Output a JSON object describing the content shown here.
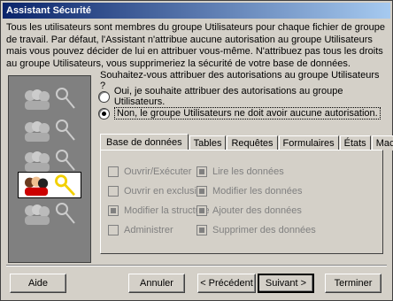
{
  "window": {
    "title": "Assistant Sécurité"
  },
  "intro": "Tous les utilisateurs sont membres du groupe Utilisateurs pour chaque fichier de groupe de travail. Par défaut, l'Assistant n'attribue aucune autorisation au groupe Utilisateurs mais vous pouvez décider de lui en attribuer vous-même. N'attribuez pas tous les droits au groupe Utilisateurs, vous supprimeriez la sécurité de votre base de données.",
  "question": "Souhaitez-vous attribuer des autorisations au groupe Utilisateurs ?",
  "options": [
    {
      "label": "Oui, je souhaite attribuer des autorisations au groupe Utilisateurs.",
      "selected": false
    },
    {
      "label": "Non, le groupe Utilisateurs ne doit avoir aucune autorisation.",
      "selected": true
    }
  ],
  "tabs": [
    "Base de données",
    "Tables",
    "Requêtes",
    "Formulaires",
    "États",
    "Macros"
  ],
  "permissions": {
    "left": [
      {
        "label": "Ouvrir/Exécuter",
        "checked": false
      },
      {
        "label": "Ouvrir en exclusif",
        "checked": false
      },
      {
        "label": "Modifier la structure",
        "checked": true
      },
      {
        "label": "Administrer",
        "checked": false
      }
    ],
    "right": [
      {
        "label": "Lire les données",
        "checked": true
      },
      {
        "label": "Modifier les données",
        "checked": true
      },
      {
        "label": "Ajouter des données",
        "checked": true
      },
      {
        "label": "Supprimer des données",
        "checked": true
      }
    ]
  },
  "buttons": {
    "help": "Aide",
    "cancel": "Annuler",
    "back": "< Précédent",
    "next": "Suivant >",
    "finish": "Terminer"
  },
  "icons": {
    "group": "users-group-icon",
    "key": "key-icon"
  },
  "colors": {
    "dialog": "#d4d0c8",
    "title_start": "#0a246a",
    "title_end": "#a6caf0",
    "key_active": "#f2d000"
  }
}
